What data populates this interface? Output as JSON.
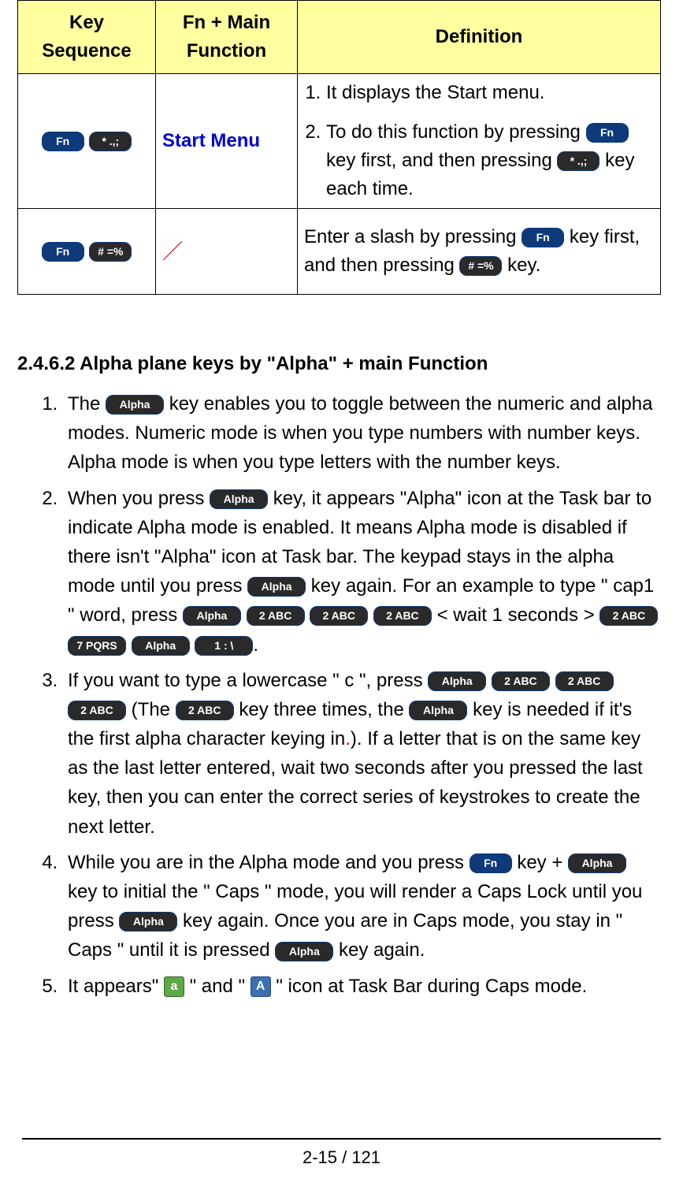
{
  "table": {
    "headers": [
      "Key Sequence",
      "Fn + Main Function",
      "Definition"
    ],
    "rows": [
      {
        "keyseq": {
          "key1": "Fn",
          "key2": "* .,;"
        },
        "mainfn": "Start Menu",
        "def": {
          "item1": "It displays the Start menu.",
          "item2a": "To do this function by pressing ",
          "item2_key1": "Fn",
          "item2b": " key first, and then pressing ",
          "item2_key2": "* .,;",
          "item2c": " key each time."
        }
      },
      {
        "keyseq": {
          "key1": "Fn",
          "key2": "# =%"
        },
        "mainfn": "／",
        "def": {
          "a": "Enter a slash by pressing ",
          "key1": "Fn",
          "b": " key first, and then pressing ",
          "key2": "# =%",
          "c": " key."
        }
      }
    ]
  },
  "heading": "2.4.6.2 Alpha plane keys by \"Alpha\" + main Function",
  "body": {
    "i1": {
      "a": "The ",
      "key": "Alpha",
      "b": " key enables you to toggle between the numeric and alpha modes. Numeric mode is when you type numbers with number keys. Alpha mode is when you type letters with the number keys."
    },
    "i2": {
      "a": "When you press ",
      "k1": "Alpha",
      "b": " key, it appears \"Alpha\" icon at the Task bar to indicate Alpha mode is enabled. It means Alpha mode is disabled if there isn't \"Alpha\" icon at Task bar. The keypad stays in the alpha mode until you press ",
      "k2": "Alpha",
      "c": " key again. For an example to type \" cap1 \" word, press ",
      "seq1": [
        "Alpha",
        "2 ABC",
        "2 ABC",
        "2 ABC"
      ],
      "d": " < wait 1 seconds > ",
      "seq2": [
        "2 ABC",
        "7 PQRS",
        "Alpha",
        "1 : \\"
      ],
      "e": "."
    },
    "i3": {
      "a": "If you want to type a lowercase \" c \", press ",
      "seq1": [
        "Alpha",
        "2 ABC",
        "2 ABC",
        "2 ABC"
      ],
      "b": " (The ",
      "k1": "2 ABC",
      "c": " key three times, the ",
      "k2": "Alpha",
      "d": " key is needed if it's the first alpha character keying in",
      "redperiod": ".",
      "e": "). If a letter that is on the same key as the last letter entered, wait two seconds after you pressed the last key, then you can enter the correct series of keystrokes to create the next letter."
    },
    "i4": {
      "a": "While you are in the Alpha mode and you press ",
      "k1": "Fn",
      "b": " key + ",
      "k2": "Alpha",
      "c": " key to initial the \" Caps \" mode, you will render a Caps Lock until you press ",
      "k3": "Alpha",
      "d": " key again. Once you are in Caps mode, you stay in \" Caps \" until it is pressed ",
      "k4": "Alpha",
      "e": " key again."
    },
    "i5": {
      "a": "It appears\" ",
      "b": " \" and \" ",
      "c": " \" icon at Task Bar during Caps mode."
    }
  },
  "footer": "2-15 / 121"
}
